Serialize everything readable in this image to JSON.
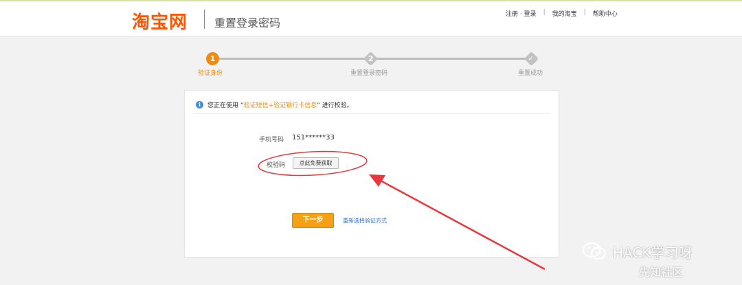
{
  "header": {
    "logo": "淘宝网",
    "page_title": "重置登录密码",
    "links": {
      "register_login": "注册 · 登录",
      "my_taobao": "我的淘宝",
      "help_center": "帮助中心",
      "separator": "|"
    }
  },
  "steps": [
    {
      "number": "1",
      "label": "验证身份",
      "state": "active"
    },
    {
      "number": "2",
      "label": "重置登录密码",
      "state": "pending"
    },
    {
      "number": "✓",
      "label": "重置成功",
      "state": "pending"
    }
  ],
  "notice": {
    "prefix": "您正在使用 “",
    "method": "验证短信+验证银行卡信息",
    "suffix": "” 进行校验。"
  },
  "form": {
    "phone_label": "手机号码",
    "phone_value": "151******33",
    "code_label": "校验码",
    "code_button": "点此免费获取",
    "next_button": "下一步",
    "reselect_link": "重新选择验证方式"
  },
  "watermark": {
    "text": "HACK学习呀",
    "sub": "先知社区"
  },
  "colors": {
    "brand": "#ff5500",
    "accent": "#f08a12",
    "link": "#2a6ab8",
    "annotation": "#e8383d"
  }
}
